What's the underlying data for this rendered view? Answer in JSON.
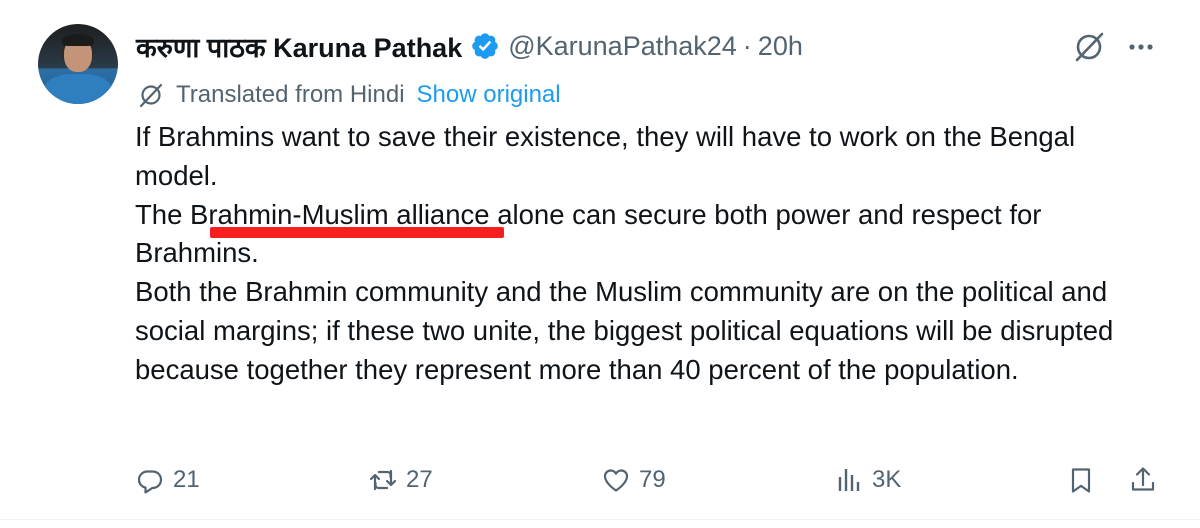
{
  "author": {
    "display_name": "करुणा पाठक Karuna Pathak",
    "handle": "@KarunaPathak24",
    "separator": "·",
    "time": "20h"
  },
  "translation": {
    "label": "Translated from Hindi",
    "show_original": "Show original"
  },
  "body": {
    "paragraphs": [
      "If Brahmins want to save their existence, they will have to work on the Bengal model.",
      "The Brahmin-Muslim alliance alone can secure both power and respect for Brahmins.",
      "Both the Brahmin community and the Muslim community are on the political and social margins; if these two unite, the biggest political equations will be disrupted because together they represent more than 40 percent of the population."
    ]
  },
  "actions": {
    "replies": "21",
    "reposts": "27",
    "likes": "79",
    "views": "3K"
  },
  "icons": {
    "verified": "verified-badge-icon",
    "grok": "grok-icon",
    "more": "more-icon",
    "translate": "translate-icon",
    "reply": "reply-icon",
    "repost": "repost-icon",
    "like": "heart-icon",
    "views": "views-icon",
    "bookmark": "bookmark-icon",
    "share": "share-icon"
  },
  "colors": {
    "text": "#0f1419",
    "secondary": "#536471",
    "link": "#1d9bf0",
    "annotation_underline": "#f71e1e"
  }
}
